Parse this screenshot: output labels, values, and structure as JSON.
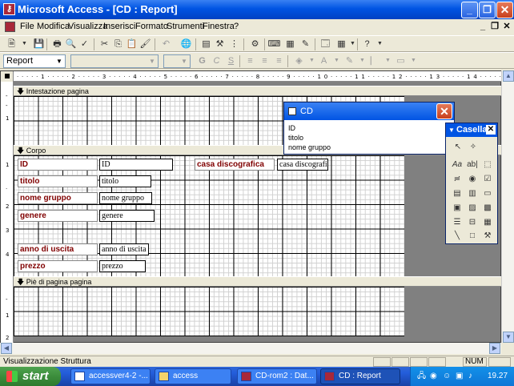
{
  "window": {
    "title": "Microsoft Access - [CD : Report]"
  },
  "menu": {
    "items": [
      "File",
      "Modifica",
      "Visualizza",
      "Inserisci",
      "Formato",
      "Strumenti",
      "Finestra",
      "?"
    ]
  },
  "format_toolbar": {
    "object_combo": "Report"
  },
  "sections": {
    "header": "Intestazione pagina",
    "body": "Corpo",
    "footer": "Piè di pagina pagina"
  },
  "controls": [
    {
      "label": "ID",
      "textbox": "ID"
    },
    {
      "label": "titolo",
      "textbox": "titolo"
    },
    {
      "label": "nome gruppo",
      "textbox": "nome gruppo"
    },
    {
      "label": "genere",
      "textbox": "genere"
    },
    {
      "label": "anno di uscita",
      "textbox": "anno di uscita"
    },
    {
      "label": "prezzo",
      "textbox": "prezzo"
    },
    {
      "label": "casa discografica",
      "textbox": "casa discografic"
    }
  ],
  "field_list": {
    "title": "CD",
    "fields": [
      "ID",
      "titolo",
      "nome gruppo"
    ]
  },
  "toolbox": {
    "title": "Casella"
  },
  "statusbar": {
    "text": "Visualizzazione Struttura",
    "num": "NUM"
  },
  "taskbar": {
    "start": "start",
    "tasks": [
      "accessver4-2 -...",
      "access",
      "CD-rom2 : Dat...",
      "CD : Report"
    ],
    "clock": "19.27"
  }
}
